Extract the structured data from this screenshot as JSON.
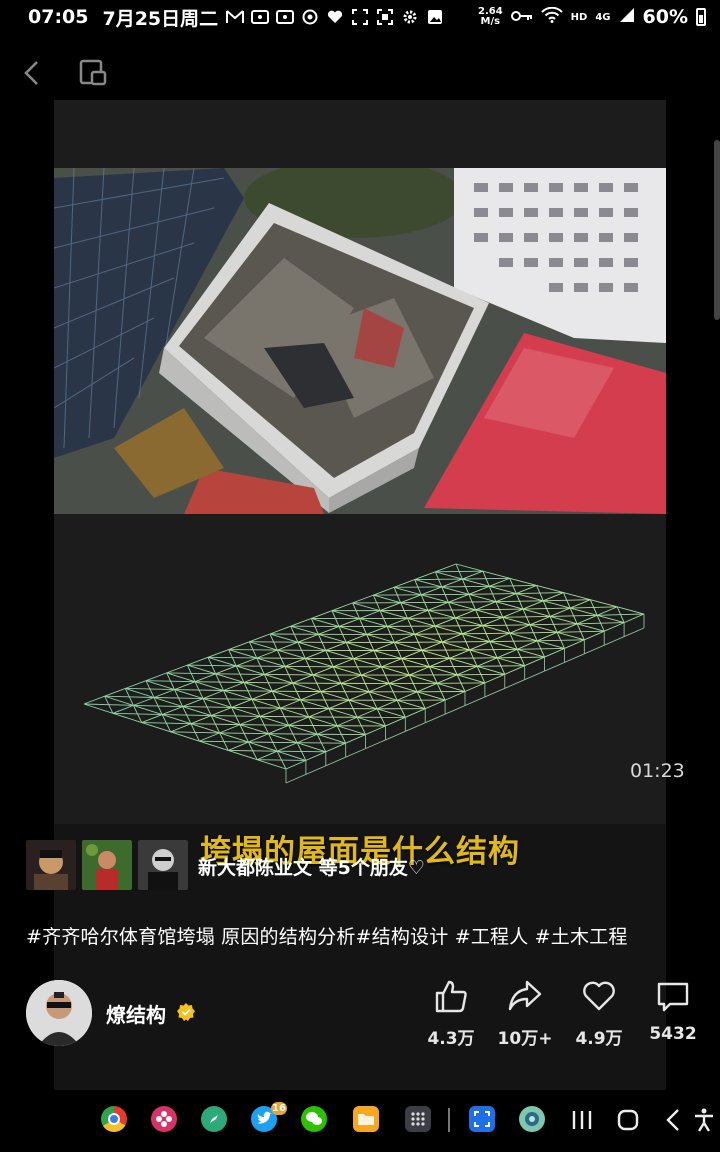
{
  "status_bar": {
    "time": "07:05",
    "date": "7月25日周二",
    "net_speed_value": "2.64",
    "net_speed_unit": "M/s",
    "network_labels": [
      "HD",
      "4G"
    ],
    "battery": "60%",
    "left_icons": [
      "gmail-icon",
      "message-icon",
      "message-icon",
      "record-icon",
      "heart-icon",
      "scan-frame-icon",
      "scan-icon",
      "settings-icon",
      "gallery-icon"
    ],
    "right_icons": [
      "key-icon",
      "wifi-icon",
      "signal-icon",
      "battery-icon"
    ]
  },
  "top_nav": {
    "back_icon": "back-chevron-icon",
    "pip_icon": "picture-in-picture-icon"
  },
  "video": {
    "duration": "01:23",
    "subtitle": "垮塌的屋面是什么结构"
  },
  "friends": {
    "text": "新大都陈业文 等5个朋友♡",
    "avatars": [
      "friend-avatar-1",
      "friend-avatar-2",
      "friend-avatar-3"
    ]
  },
  "post": {
    "hashtags": "#齐齐哈尔体育馆垮塌 原因的结构分析#结构设计 #工程人 #土木工程"
  },
  "author": {
    "name": "燎结构",
    "verified_icon": "verified-badge-icon"
  },
  "actions": [
    {
      "icon": "thumbs-up-icon",
      "count": "4.3万"
    },
    {
      "icon": "share-icon",
      "count": "10万+"
    },
    {
      "icon": "heart-icon",
      "count": "4.9万"
    },
    {
      "icon": "comment-icon",
      "count": "5432"
    }
  ],
  "taskbar": {
    "apps": [
      "chrome-icon",
      "flower-app-icon",
      "compass-app-icon",
      "twitter-icon",
      "wechat-icon",
      "files-icon",
      "app-drawer-icon",
      "screenshot-icon",
      "browser-icon"
    ],
    "twitter_badge": "16",
    "nav": [
      "recents-icon",
      "home-icon",
      "back-icon",
      "accessibility-icon"
    ]
  },
  "colors": {
    "background": "#000000",
    "panel": "#141414",
    "subtitle": "#e0b81a",
    "verified": "#f4c21b"
  }
}
